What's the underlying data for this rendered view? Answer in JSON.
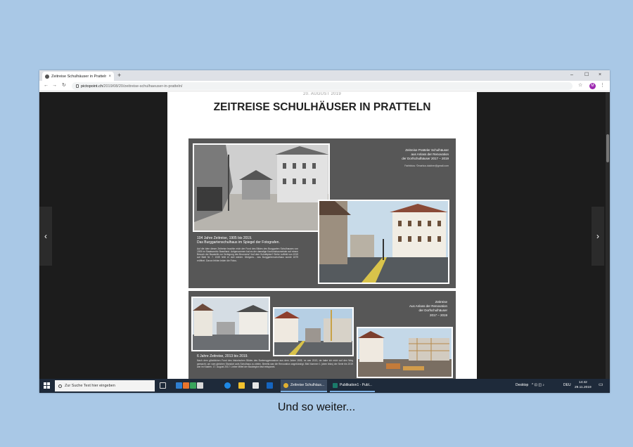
{
  "browser": {
    "tab_title": "Zeitreise Schulhäuser in Pratteln",
    "tab_close": "×",
    "new_tab": "+",
    "window_minimize": "–",
    "window_maximize": "☐",
    "window_close": "×",
    "back": "←",
    "forward": "→",
    "reload": "↻",
    "url_domain": "pictopoint.ch",
    "url_path": "/2019/08/20/zeitreise-schulhaeuser-in-pratteln/",
    "bookmark": "☆",
    "profile_initial": "M",
    "menu": "⋮"
  },
  "article": {
    "date": "20. AUGUST 2019",
    "title": "ZEITREISE SCHULHÄUSER IN PRATTELN",
    "prev_arrow": "‹",
    "next_arrow": "›"
  },
  "poster": {
    "panel1_caption": [
      "Zeitreise Pratteler Schulhäuser",
      "aus Anlass der Renovation",
      "der Dorfschulhäuser 2017 – 2019"
    ],
    "panel1_credit": "Farbfotos: ©markus.dalcher@gmail.com",
    "panel1_heading": [
      "104 Jahre Zeitreise, 1905 bis 2019.",
      "Das Burggartenschulhaus im Spiegel der Fotografen."
    ],
    "panel1_body": "Auf die Idee dieser Zeitreise brachte mich der Fund des Bildes des Burggarten Schulhauses von 1905 im Staatsarchiv Baselland. Aufgenommen hat es der damalige Kantonsbaumeister auf einem Besuch der Baustelle zur Verlegung des Brunnens? Auf dem Schnittplan? Siehe Luftbild von 1919 auf Blatt Nr. 7. 1949 fehlt er dort wieder. Übrigens... das Burggartenschulhaus wurde 1879 eröffnet. Davon fehlen leider die Fotos.",
    "panel2_caption": [
      "Zeitreise",
      "Aus Anlass der Renovation",
      "der Dorfschulhäuser",
      "2017 – 2019"
    ],
    "panel2_heading": "6 Jahre Zeitreise, 2013 bis 2019.",
    "panel2_body": "Nach dem glücklichen Fund des historischen Bildes des Burkersgymnasium aus dem Jahre 1905, es war 2013, da habe ich mich auf den Weg gemacht, um vom gleichen Standort aufs Schulhaus zu zielen. Bereits war die Renovation angekündigt. Bild Nummer 1 (oben links) der Serie bis 2019 war im Kasten. 17. August 2017: Lieber Mittel der Baubeginn fast entspannt."
  },
  "taskbar": {
    "search_placeholder": "Zur Suche Text hier eingeben",
    "task1": "Zeitreise Schulhäus...",
    "task2": "Publikation1 - Publ...",
    "desktop_label": "Desktop",
    "tray_icons": "^ ⊡ ◫ ♪",
    "lang": "DEU",
    "time": "14:42",
    "date": "29.11.2019",
    "notification": "▭"
  },
  "footer_caption": "Und so weiter...",
  "colors": {
    "background": "#a9c8e6",
    "poster_panel": "#575757",
    "viewport": "#1c1c1c",
    "taskbar": "#1e2a3a",
    "profile": "#9c27b0"
  }
}
